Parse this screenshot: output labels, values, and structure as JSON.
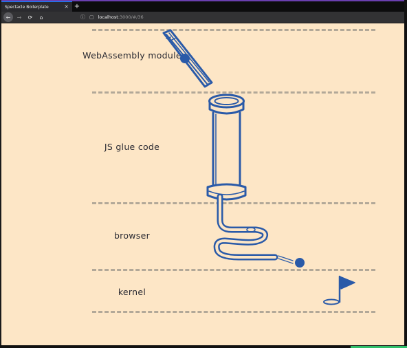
{
  "browser": {
    "tab_title": "Spectacle Boilerplate",
    "tab_close": "×",
    "new_tab": "+",
    "url_host": "localhost",
    "url_rest": ":3000/#/36",
    "nav_back": "←",
    "nav_forward": "→",
    "nav_reload": "⟳",
    "nav_home": "⌂"
  },
  "slide": {
    "layers": [
      {
        "label": "WebAssembly module"
      },
      {
        "label": "JS glue code"
      },
      {
        "label": "browser"
      },
      {
        "label": "kernel"
      }
    ],
    "colors": {
      "background": "#fde6c6",
      "ink": "#2a5aa8",
      "dash": "#b2a898"
    },
    "icons": [
      "tilted-pipe-icon",
      "ball-icon",
      "cylinder-pipe-icon",
      "coil-pipe-icon",
      "golf-hole-flag-icon"
    ]
  }
}
